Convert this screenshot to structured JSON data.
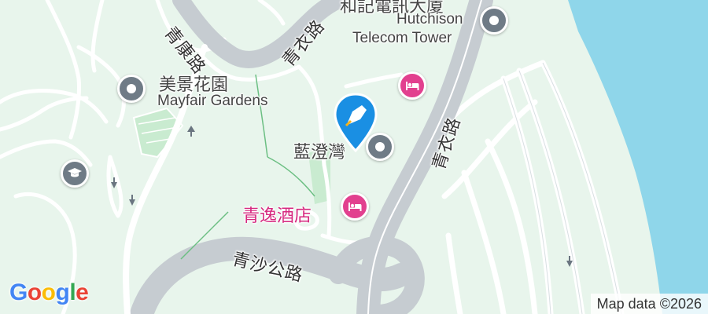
{
  "map": {
    "colors": {
      "land": "#e8f5ec",
      "park": "#c9ebd0",
      "water": "#8fd6ea",
      "road": "#ffffff",
      "highway": "#c6ccd1",
      "poi_grey": "#6f7b86",
      "hotel": "#e2408f",
      "hotel_text": "#d6287f"
    },
    "labels": {
      "road_ching_hong": "青康路",
      "road_tsing_yi_top": "青衣路",
      "road_tsing_yi_right": "青衣路",
      "road_tsing_sha": "青沙公路",
      "hutchison_zh": "和記電訊大廈",
      "hutchison_en_1": "Hutchison",
      "hutchison_en_2": "Telecom Tower",
      "mayfair_zh": "美景花園",
      "mayfair_en": "Mayfair Gardens",
      "lam_tang": "藍澄灣",
      "hotel_name": "青逸酒店"
    },
    "icons": [
      "landmark-icon",
      "hotel-icon",
      "school-icon",
      "selected-location-pin-icon"
    ],
    "attribution": "Map data ©2026",
    "logo": {
      "text": "Google",
      "letters": [
        "G",
        "o",
        "o",
        "g",
        "l",
        "e"
      ],
      "colors": [
        "#4285F4",
        "#EA4335",
        "#FBBC05",
        "#4285F4",
        "#34A853",
        "#EA4335"
      ]
    }
  }
}
